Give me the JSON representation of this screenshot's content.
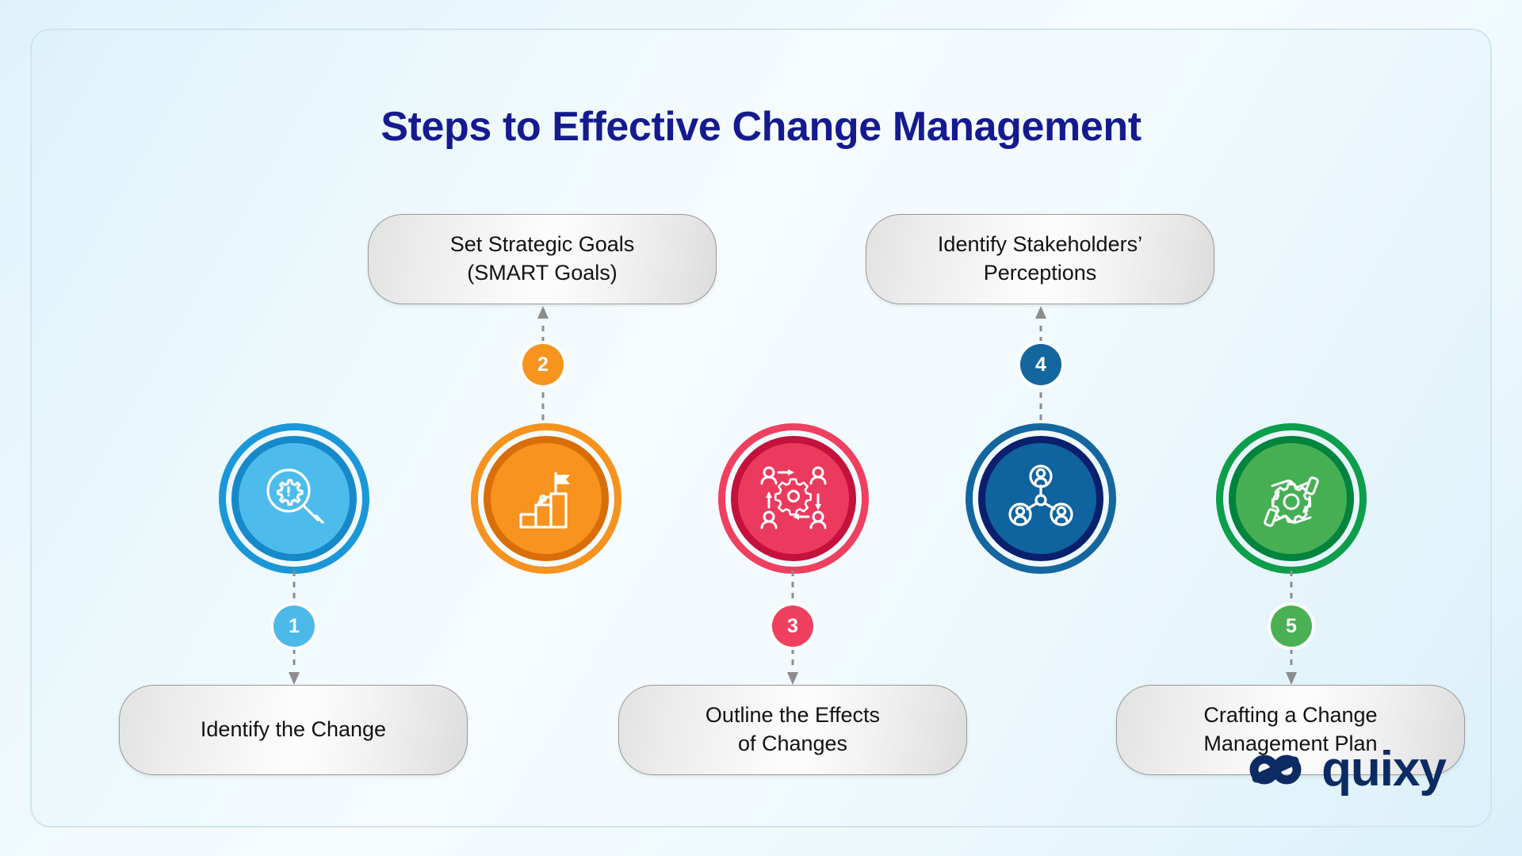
{
  "page": {
    "title": "Steps to Effective Change Management",
    "title_color": "#151a8f",
    "background_color": "#e9f7fc"
  },
  "steps": [
    {
      "number": "1",
      "label": "Identify the Change",
      "label_position": "bottom",
      "icon": "magnifier-gear-icon",
      "color": "#29a7e0",
      "ring_color": "#1a97d8",
      "ring_inner_color": "#1689c9",
      "fill_color": "#4dbced",
      "badge_color": "#4cb9e8"
    },
    {
      "number": "2",
      "label": "Set Strategic Goals\n(SMART Goals)",
      "label_line1": "Set Strategic Goals",
      "label_line2": "(SMART Goals)",
      "label_position": "top",
      "icon": "flag-steps-growth-icon",
      "color": "#f6921e",
      "ring_color": "#f6921e",
      "ring_inner_color": "#d96e09",
      "fill_color": "#f7931e",
      "badge_color": "#f7941d"
    },
    {
      "number": "3",
      "label": "Outline the Effects\nof Changes",
      "label_line1": "Outline the Effects",
      "label_line2": "of Changes",
      "label_position": "bottom",
      "icon": "people-gear-arrows-icon",
      "color": "#ee3d62",
      "ring_color": "#ef4060",
      "ring_inner_color": "#c4123c",
      "fill_color": "#ec3a5e",
      "badge_color": "#ef4060"
    },
    {
      "number": "4",
      "label": "Identify Stakeholders’\nPerceptions",
      "label_line1": "Identify Stakeholders’",
      "label_line2": "Perceptions",
      "label_position": "top",
      "icon": "stakeholder-network-icon",
      "color": "#14669e",
      "ring_color": "#14669e",
      "ring_inner_color": "#0a1f6e",
      "fill_color": "#0f639f",
      "badge_color": "#14669e"
    },
    {
      "number": "5",
      "label": "Crafting a Change\nManagement Plan",
      "label_line1": "Crafting a Change",
      "label_line2": "Management Plan",
      "label_position": "bottom",
      "icon": "hands-gear-cycle-icon",
      "color": "#0c9e4b",
      "ring_color": "#0c9e4b",
      "ring_inner_color": "#00833d",
      "fill_color": "#46af54",
      "badge_color": "#4bb053"
    }
  ],
  "branding": {
    "logo_name": "quixy",
    "logo_icon": "quixy-infinity-knot-icon",
    "logo_color": "#0d2b63"
  },
  "connector": {
    "style": "dashed",
    "color": "#8d8d8d"
  }
}
